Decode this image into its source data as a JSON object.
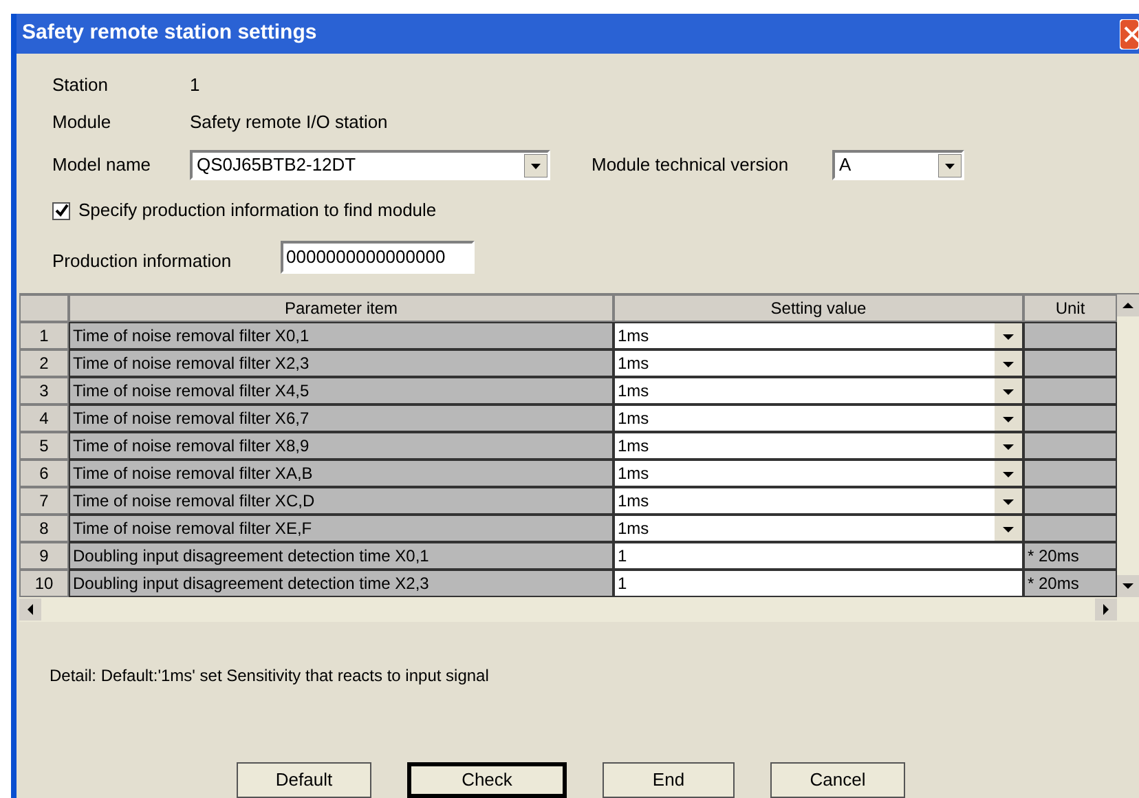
{
  "window": {
    "title": "Safety remote station settings"
  },
  "station": {
    "label": "Station",
    "value": "1"
  },
  "module": {
    "label": "Module",
    "value": "Safety remote I/O station"
  },
  "model_name": {
    "label": "Model name",
    "value": "QS0J65BTB2-12DT"
  },
  "technical_version": {
    "label": "Module technical version",
    "value": "A"
  },
  "specify_production": {
    "label": "Specify production information to find module",
    "checked": true
  },
  "production_information": {
    "label": "Production information",
    "value": "0000000000000000"
  },
  "table": {
    "columns": [
      "Parameter item",
      "Setting value",
      "Unit"
    ],
    "rows": [
      {
        "number": "1",
        "item": "Time of noise removal filter X0,1",
        "value": "1ms",
        "kind": "dropdown"
      },
      {
        "number": "2",
        "item": "Time of noise removal filter X2,3",
        "value": "1ms",
        "kind": "dropdown"
      },
      {
        "number": "3",
        "item": "Time of noise removal filter X4,5",
        "value": "1ms",
        "kind": "dropdown"
      },
      {
        "number": "4",
        "item": "Time of noise removal filter X6,7",
        "value": "1ms",
        "kind": "dropdown"
      },
      {
        "number": "5",
        "item": "Time of noise removal filter X8,9",
        "value": "1ms",
        "kind": "dropdown"
      },
      {
        "number": "6",
        "item": "Time of noise removal filter XA,B",
        "value": "1ms",
        "kind": "dropdown"
      },
      {
        "number": "7",
        "item": "Time of noise removal filter XC,D",
        "value": "1ms",
        "kind": "dropdown"
      },
      {
        "number": "8",
        "item": "Time of noise removal filter XE,F",
        "value": "1ms",
        "kind": "dropdown"
      },
      {
        "number": "9",
        "item": "Doubling input disagreement detection time X0,1",
        "value": "1",
        "unit": "* 20ms",
        "kind": "text"
      },
      {
        "number": "10",
        "item": "Doubling input disagreement detection time X2,3",
        "value": "1",
        "unit": "* 20ms",
        "kind": "text"
      }
    ]
  },
  "detail": "Detail:  Default:'1ms'  set Sensitivity that reacts to input signal",
  "buttons": [
    {
      "label": "Default",
      "focused": false
    },
    {
      "label": "Check",
      "focused": true
    },
    {
      "label": "End",
      "focused": false
    },
    {
      "label": "Cancel",
      "focused": false
    }
  ]
}
